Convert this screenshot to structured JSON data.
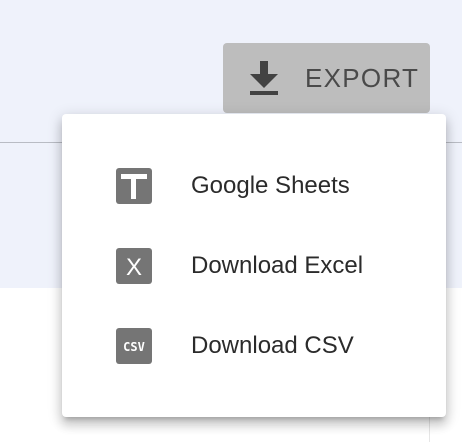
{
  "export_button": {
    "label": "EXPORT",
    "icon": "download-icon"
  },
  "menu": {
    "items": [
      {
        "label": "Google Sheets",
        "icon": "google-sheets-icon"
      },
      {
        "label": "Download Excel",
        "icon": "excel-icon",
        "icon_text": "X"
      },
      {
        "label": "Download CSV",
        "icon": "csv-icon",
        "icon_text": "CSV"
      }
    ]
  },
  "colors": {
    "icon_gray": "#757575",
    "button_bg": "#bdbdbd",
    "page_bg": "#eff2fb"
  }
}
